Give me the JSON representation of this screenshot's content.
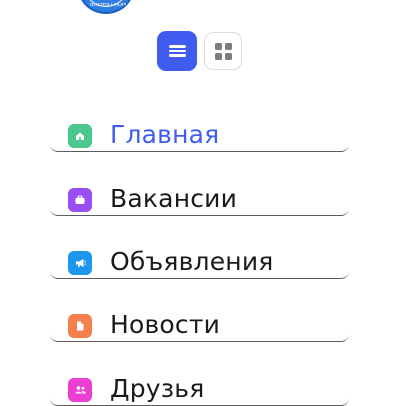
{
  "logo": {
    "text": "ВОЕННО-МОРСКОЕ УЧЕБНОЕ",
    "color": "#2f7de0"
  },
  "view_toggle": {
    "active": "list",
    "accent": "#3f5bf0"
  },
  "nav": {
    "items": [
      {
        "label": "Главная",
        "icon": "home-icon",
        "color": "#4cc790",
        "active": true
      },
      {
        "label": "Вакансии",
        "icon": "briefcase-icon",
        "color": "#9a4df2",
        "active": false
      },
      {
        "label": "Объявления",
        "icon": "megaphone-icon",
        "color": "#1e96ec",
        "active": false
      },
      {
        "label": "Новости",
        "icon": "document-icon",
        "color": "#f57f4d",
        "active": false
      },
      {
        "label": "Друзья",
        "icon": "friends-icon",
        "color": "#ec3ed2",
        "active": false
      }
    ]
  }
}
